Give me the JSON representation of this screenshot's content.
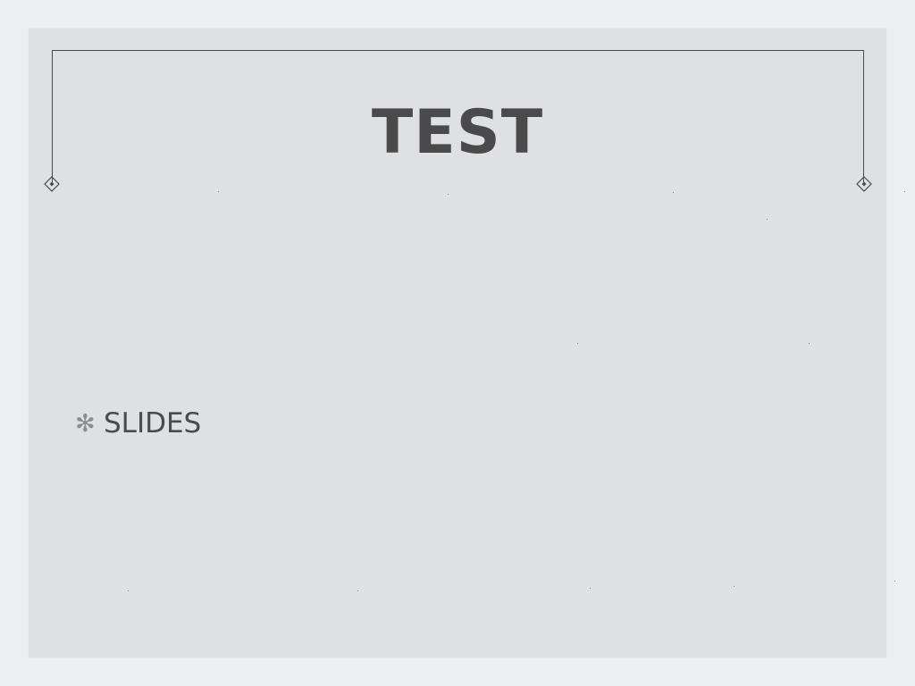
{
  "slide": {
    "title": "TEST",
    "bullet_icon": "asterisk-bullet-icon",
    "bullets": [
      {
        "label": "SLIDES"
      }
    ]
  },
  "colors": {
    "page_background": "#eeeff1",
    "slide_background": "#dfe0e3",
    "title_text": "#4a4a4b",
    "body_text": "#4b4b4d",
    "frame_line": "#4a4a4a",
    "bullet": "#8b8d92"
  }
}
